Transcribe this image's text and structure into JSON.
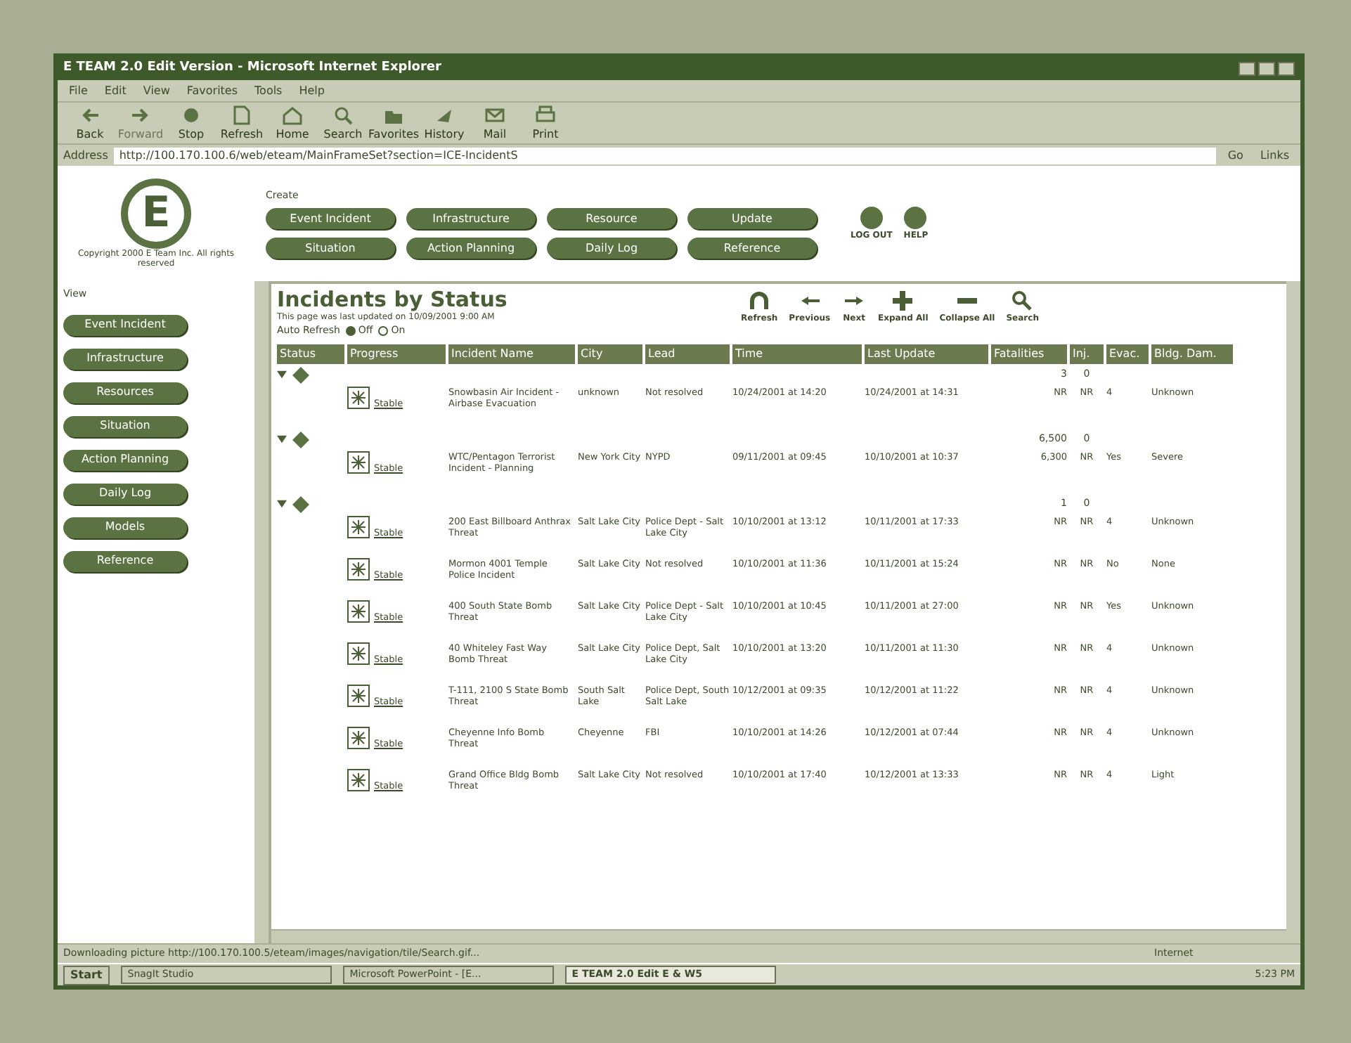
{
  "window": {
    "title": "E TEAM 2.0 Edit Version - Microsoft Internet Explorer"
  },
  "menu": [
    "File",
    "Edit",
    "View",
    "Favorites",
    "Tools",
    "Help"
  ],
  "toolbar": [
    {
      "label": "Back",
      "disabled": false
    },
    {
      "label": "Forward",
      "disabled": true
    },
    {
      "label": "Stop",
      "disabled": false
    },
    {
      "label": "Refresh",
      "disabled": false
    },
    {
      "label": "Home",
      "disabled": false
    },
    {
      "label": "Search",
      "disabled": false
    },
    {
      "label": "Favorites",
      "disabled": false
    },
    {
      "label": "History",
      "disabled": false
    },
    {
      "label": "Mail",
      "disabled": false
    },
    {
      "label": "Print",
      "disabled": false
    }
  ],
  "address": {
    "label": "Address",
    "value": "http://100.170.100.6/web/eteam/MainFrameSet?section=ICE-IncidentS",
    "go": "Go",
    "links": "Links"
  },
  "logo": {
    "letter": "E",
    "caption": "Copyright 2000 E Team Inc. All rights reserved"
  },
  "create": {
    "label": "Create",
    "buttons": [
      "Event Incident",
      "Infrastructure",
      "Resource",
      "Update",
      "Situation",
      "Action Planning",
      "Daily Log",
      "Reference"
    ]
  },
  "top_actions": [
    "LOG OUT",
    "HELP"
  ],
  "view": {
    "label": "View",
    "items": [
      "Event Incident",
      "Infrastructure",
      "Resources",
      "Situation",
      "Action Planning",
      "Daily Log",
      "Models",
      "Reference"
    ]
  },
  "content": {
    "title": "Incidents by Status",
    "updated": "This page was last updated on 10/09/2001 9:00 AM",
    "auto_refresh": {
      "label": "Auto Refresh",
      "options": [
        {
          "label": "Off",
          "selected": true
        },
        {
          "label": "On",
          "selected": false
        }
      ]
    },
    "tools": [
      "Refresh",
      "Previous",
      "Next",
      "Expand All",
      "Collapse All",
      "Search"
    ],
    "columns": [
      "Status",
      "Progress",
      "Incident Name",
      "City",
      "Lead",
      "Time",
      "Last Update",
      "Fatalities",
      "Inj.",
      "Evac.",
      "Bldg. Dam."
    ],
    "rows": [
      {
        "kind": "group",
        "expanded": true,
        "fatalities": "3",
        "injuries": "0"
      },
      {
        "kind": "incident",
        "progress": "Stable",
        "name": "Snowbasin Air Incident - Airbase Evacuation",
        "city": "unknown",
        "lead": "Not resolved",
        "time": "10/24/2001 at 14:20",
        "update": "10/24/2001 at 14:31",
        "fatalities": "NR",
        "injuries": "NR",
        "evac": "4",
        "damage": "Unknown"
      },
      {
        "kind": "group",
        "expanded": true,
        "fatalities": "6,500",
        "injuries": "0"
      },
      {
        "kind": "incident",
        "progress": "Stable",
        "name": "WTC/Pentagon Terrorist Incident - Planning",
        "city": "New York City",
        "lead": "NYPD",
        "time": "09/11/2001 at 09:45",
        "update": "10/10/2001 at 10:37",
        "fatalities": "6,300",
        "injuries": "NR",
        "evac": "Yes",
        "damage": "Severe"
      },
      {
        "kind": "group",
        "expanded": true,
        "fatalities": "1",
        "injuries": "0"
      },
      {
        "kind": "incident",
        "progress": "Stable",
        "name": "200 East Billboard Anthrax Threat",
        "city": "Salt Lake City",
        "lead": "Police Dept - Salt Lake City",
        "time": "10/10/2001 at 13:12",
        "update": "10/11/2001 at 17:33",
        "fatalities": "NR",
        "injuries": "NR",
        "evac": "4",
        "damage": "Unknown"
      },
      {
        "kind": "incident",
        "progress": "Stable",
        "name": "Mormon 4001 Temple Police Incident",
        "city": "Salt Lake City",
        "lead": "Not resolved",
        "time": "10/10/2001 at 11:36",
        "update": "10/11/2001 at 15:24",
        "fatalities": "NR",
        "injuries": "NR",
        "evac": "No",
        "damage": "None"
      },
      {
        "kind": "incident",
        "progress": "Stable",
        "name": "400 South State Bomb Threat",
        "city": "Salt Lake City",
        "lead": "Police Dept - Salt Lake City",
        "time": "10/10/2001 at 10:45",
        "update": "10/11/2001 at 27:00",
        "fatalities": "NR",
        "injuries": "NR",
        "evac": "Yes",
        "damage": "Unknown"
      },
      {
        "kind": "incident",
        "progress": "Stable",
        "name": "40 Whiteley Fast Way Bomb Threat",
        "city": "Salt Lake City",
        "lead": "Police Dept, Salt Lake City",
        "time": "10/10/2001 at 13:20",
        "update": "10/11/2001 at 11:30",
        "fatalities": "NR",
        "injuries": "NR",
        "evac": "4",
        "damage": "Unknown"
      },
      {
        "kind": "incident",
        "progress": "Stable",
        "name": "T-111, 2100 S State Bomb Threat",
        "city": "South Salt Lake",
        "lead": "Police Dept, South Salt Lake",
        "time": "10/12/2001 at 09:35",
        "update": "10/12/2001 at 11:22",
        "fatalities": "NR",
        "injuries": "NR",
        "evac": "4",
        "damage": "Unknown"
      },
      {
        "kind": "incident",
        "progress": "Stable",
        "name": "Cheyenne Info Bomb Threat",
        "city": "Cheyenne",
        "lead": "FBI",
        "time": "10/10/2001 at 14:26",
        "update": "10/12/2001 at 07:44",
        "fatalities": "NR",
        "injuries": "NR",
        "evac": "4",
        "damage": "Unknown"
      },
      {
        "kind": "incident",
        "progress": "Stable",
        "name": "Grand Office Bldg Bomb Threat",
        "city": "Salt Lake City",
        "lead": "Not resolved",
        "time": "10/10/2001 at 17:40",
        "update": "10/12/2001 at 13:33",
        "fatalities": "NR",
        "injuries": "NR",
        "evac": "4",
        "damage": "Light"
      }
    ]
  },
  "status_bar": {
    "text": "Downloading picture http://100.170.100.5/eteam/images/navigation/tile/Search.gif...",
    "zone": "Internet"
  },
  "taskbar": {
    "start": "Start",
    "tasks": [
      {
        "label": "SnagIt Studio",
        "selected": false
      },
      {
        "label": "Microsoft PowerPoint - [E...",
        "selected": false
      },
      {
        "label": "E TEAM 2.0 Edit E & W5",
        "selected": true
      }
    ],
    "clock": "5:23 PM"
  }
}
